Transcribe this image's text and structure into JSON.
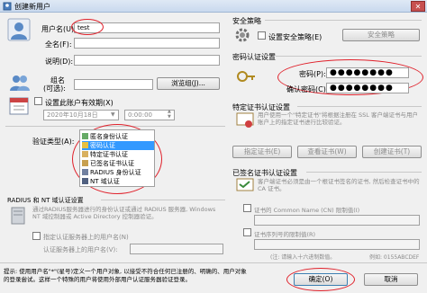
{
  "window": {
    "title": "创建新用户",
    "close_label": "✕"
  },
  "user": {
    "username_label": "用户名(U):",
    "username_value": "test",
    "fullname_label": "全名(F):",
    "fullname_value": "",
    "desc_label": "说明(D):",
    "desc_value": "",
    "group_label": "组名\n(可选):",
    "group_label_1": "组名",
    "group_label_2": "(可选):",
    "group_value": "",
    "browse_label": "浏览组(J)...",
    "expire_label": "设置此账户有效期(X)",
    "expire_date": "2020年10月18日",
    "expire_time": "0:00:00"
  },
  "auth": {
    "label": "验证类型(A):",
    "items": [
      "匿名身份认证",
      "密码认证",
      "特定证书认证",
      "已签名证书认证",
      "RADIUS 身份认证",
      "NT 域认证"
    ],
    "selected_index": 1
  },
  "radius": {
    "title": "RADIUS 和 NT 域认证设置",
    "desc": "通过RADIUS服务器进行的身份认证或通过 RADIUS 服务器, Windows NT 域控制器或 Active Directory 控制器验证。",
    "specify_label": "指定认证服务器上的用户名(N)",
    "server_user_label": "认证服务器上的用户名(V):",
    "server_user_value": ""
  },
  "security": {
    "title": "安全策略",
    "checkbox_label": "设置安全策略(E)",
    "button_label": "安全策略"
  },
  "password": {
    "title": "密码认证设置",
    "pwd_label": "密码(P):",
    "pwd_value": "●●●●●●●●",
    "confirm_label": "确认密码(C):",
    "confirm_value": "●●●●●●●●"
  },
  "cert": {
    "title": "特定证书认证设置",
    "desc": "用户使用一个\"特定证书\"将根据注册在 SSL 客户端证书与用户账户上的指定证书进行比较验证。",
    "btn_specify": "指定证书(E)",
    "btn_view": "查看证书(W)",
    "btn_create": "创建证书(T)"
  },
  "signed": {
    "title": "已签名证书认证设置",
    "desc": "客户端证书必须是由一个根证书签名的证书, 然后检查证书中的 CA 证书。",
    "cn_label": "证书的 Common Name (CN) 限制值(I)",
    "cn_value": "",
    "serial_label": "证书序列号的限制值(R)",
    "serial_value": "",
    "hint": "例如: 0155ABCDEF",
    "hint_prefix": "(注: 请输入十六进制数值。"
  },
  "footer": {
    "tip_line1": "提示: 使用用户名\"*\"(星号)定义一个用户对象, 以接受不符合任何已注册的、明确的、用户对象",
    "tip_line2": "的登录尝试。这样一个特殊的用户将使用外部用户认证服务器验证登录。",
    "ok_label": "确定(O)",
    "cancel_label": "取消"
  },
  "colors": {
    "accent": "#3399ff",
    "highlight": "#e0212b"
  }
}
